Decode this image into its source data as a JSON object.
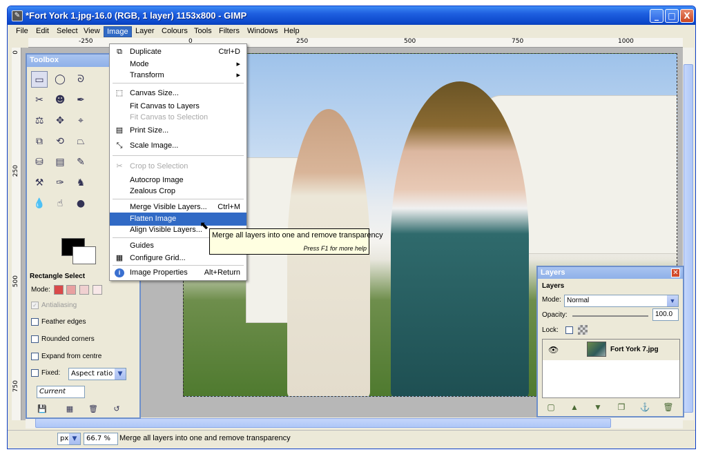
{
  "window": {
    "title": "*Fort York 1.jpg-16.0 (RGB, 1 layer) 1153x800 - GIMP",
    "controls": [
      "_",
      "□",
      "X"
    ]
  },
  "menubar": [
    "File",
    "Edit",
    "Select",
    "View",
    "Image",
    "Layer",
    "Colours",
    "Tools",
    "Filters",
    "Windows",
    "Help"
  ],
  "hruler_ticks": [
    "-250",
    "0",
    "250",
    "500",
    "750",
    "1000"
  ],
  "vruler_ticks": [
    "0",
    "250",
    "500",
    "750"
  ],
  "image_menu": {
    "items": [
      {
        "label": "Duplicate",
        "shortcut": "Ctrl+D",
        "icon": "duplicate-icon",
        "disabled": false
      },
      {
        "label": "Mode",
        "shortcut": "▸",
        "icon": "",
        "disabled": false
      },
      {
        "label": "Transform",
        "shortcut": "▸",
        "icon": "",
        "disabled": false
      },
      {
        "label": "Canvas Size...",
        "shortcut": "",
        "icon": "canvas-size-icon",
        "disabled": false
      },
      {
        "label": "Fit Canvas to Layers",
        "shortcut": "",
        "icon": "",
        "disabled": false
      },
      {
        "label": "Fit Canvas to Selection",
        "shortcut": "",
        "icon": "",
        "disabled": true
      },
      {
        "label": "Print Size...",
        "shortcut": "",
        "icon": "print-size-icon",
        "disabled": false
      },
      {
        "label": "Scale Image...",
        "shortcut": "",
        "icon": "scale-image-icon",
        "disabled": false
      },
      {
        "label": "Crop to Selection",
        "shortcut": "",
        "icon": "crop-icon",
        "disabled": true
      },
      {
        "label": "Autocrop Image",
        "shortcut": "",
        "icon": "",
        "disabled": false
      },
      {
        "label": "Zealous Crop",
        "shortcut": "",
        "icon": "",
        "disabled": false
      },
      {
        "label": "Merge Visible Layers...",
        "shortcut": "Ctrl+M",
        "icon": "",
        "disabled": false
      },
      {
        "label": "Flatten Image",
        "shortcut": "",
        "icon": "",
        "disabled": false
      },
      {
        "label": "Align Visible Layers...",
        "shortcut": "",
        "icon": "",
        "disabled": false
      },
      {
        "label": "Guides",
        "shortcut": "",
        "icon": "",
        "disabled": false
      },
      {
        "label": "Configure Grid...",
        "shortcut": "",
        "icon": "grid-icon",
        "disabled": false
      },
      {
        "label": "Image Properties",
        "shortcut": "Alt+Return",
        "icon": "info-icon",
        "disabled": false
      }
    ],
    "highlighted": "Flatten Image"
  },
  "tooltip": {
    "text": "Merge all layers into one and remove transparency",
    "help": "Press F1 for more help"
  },
  "toolbox": {
    "title": "Toolbox",
    "options_title": "Rectangle Select",
    "mode_label": "Mode:",
    "antialiasing": "Antialiasing",
    "feather": "Feather edges",
    "rounded": "Rounded corners",
    "expand": "Expand from centre",
    "fixed": "Fixed:",
    "fixed_value": "Aspect ratio",
    "current": "Current"
  },
  "layers": {
    "title": "Layers",
    "section": "Layers",
    "mode_label": "Mode:",
    "mode_value": "Normal",
    "opacity_label": "Opacity:",
    "opacity_value": "100.0",
    "lock_label": "Lock:",
    "layer_name": "Fort York 7.jpg"
  },
  "statusbar": {
    "unit": "px",
    "zoom": "66.7 %",
    "message": "Merge all layers into one and remove transparency"
  }
}
